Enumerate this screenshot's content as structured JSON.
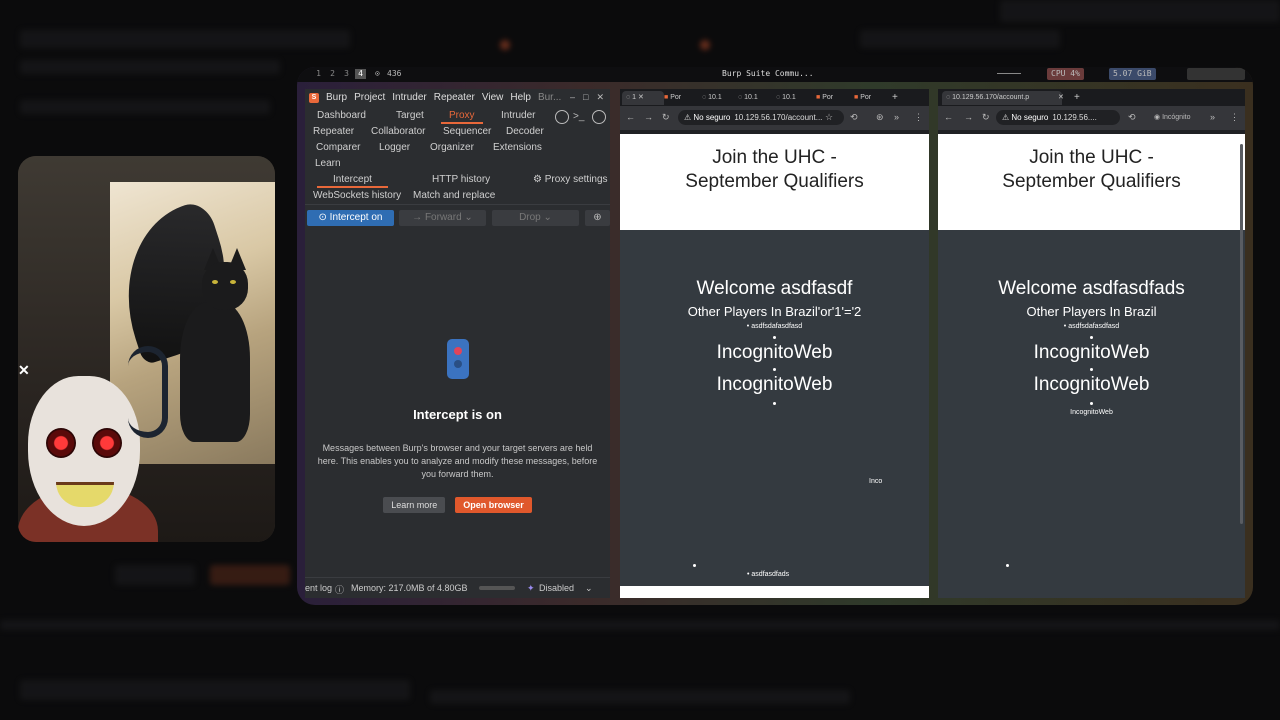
{
  "topbar": {
    "workspaces": [
      "1",
      "2",
      "3",
      "4"
    ],
    "counter": "436",
    "title": "Burp Suite Commu...",
    "cpu": "CPU 4%",
    "mem": "5.07 GiB"
  },
  "burp": {
    "logo": "S",
    "menu": [
      "Burp",
      "Project",
      "Intruder",
      "Repeater",
      "View",
      "Help",
      "Bur..."
    ],
    "tabs": {
      "dashboard": "Dashboard",
      "target": "Target",
      "proxy": "Proxy",
      "intruder": "Intruder",
      "repeater": "Repeater",
      "collaborator": "Collaborator",
      "sequencer": "Sequencer",
      "decoder": "Decoder",
      "comparer": "Comparer",
      "logger": "Logger",
      "organizer": "Organizer",
      "extensions": "Extensions",
      "learn": "Learn"
    },
    "subtabs": {
      "intercept": "Intercept",
      "http_history": "HTTP history",
      "proxy_settings": "Proxy settings",
      "websockets": "WebSockets history",
      "match_replace": "Match and replace"
    },
    "toolbar": {
      "intercept_on": "Intercept on",
      "forward": "Forward",
      "drop": "Drop"
    },
    "heading": "Intercept is on",
    "description": "Messages between Burp's browser and your target servers are held here. This enables you to analyze and modify these messages, before you forward them.",
    "learn_more": "Learn more",
    "open_browser": "Open browser",
    "status": {
      "event_log": "ent log",
      "memory": "Memory: 217.0MB of 4.80GB",
      "ai": "Disabled"
    }
  },
  "browser1": {
    "tabs": [
      "1",
      "Por",
      "10.1",
      "10.1",
      "10.1",
      "Por",
      "Por"
    ],
    "no_seguro": "No seguro",
    "url": "10.129.56.170/account...",
    "hero_line1": "Join the UHC -",
    "hero_line2": "September Qualifiers",
    "welcome": "Welcome asdfasdf",
    "others": "Other Players In Brazil'or'1'='2",
    "player1": "asdfsdafasdfasd",
    "big1": "IncognitoWeb",
    "big2": "IncognitoWeb",
    "trail": "Inco",
    "player_last": "asdfasdfads"
  },
  "browser2": {
    "tab": "10.129.56.170/account.p",
    "no_seguro": "No seguro",
    "url": "10.129.56....",
    "incognito": "Incógnito",
    "hero_line1": "Join the UHC -",
    "hero_line2": "September Qualifiers",
    "welcome": "Welcome asdfasdfads",
    "others": "Other Players In Brazil",
    "player1": "asdfsdafasdfasd",
    "big1": "IncognitoWeb",
    "big2": "IncognitoWeb",
    "small_last": "IncognitoWeb"
  },
  "colors": {
    "accent": "#e8683a",
    "intercept_blue": "#2f6db3"
  }
}
